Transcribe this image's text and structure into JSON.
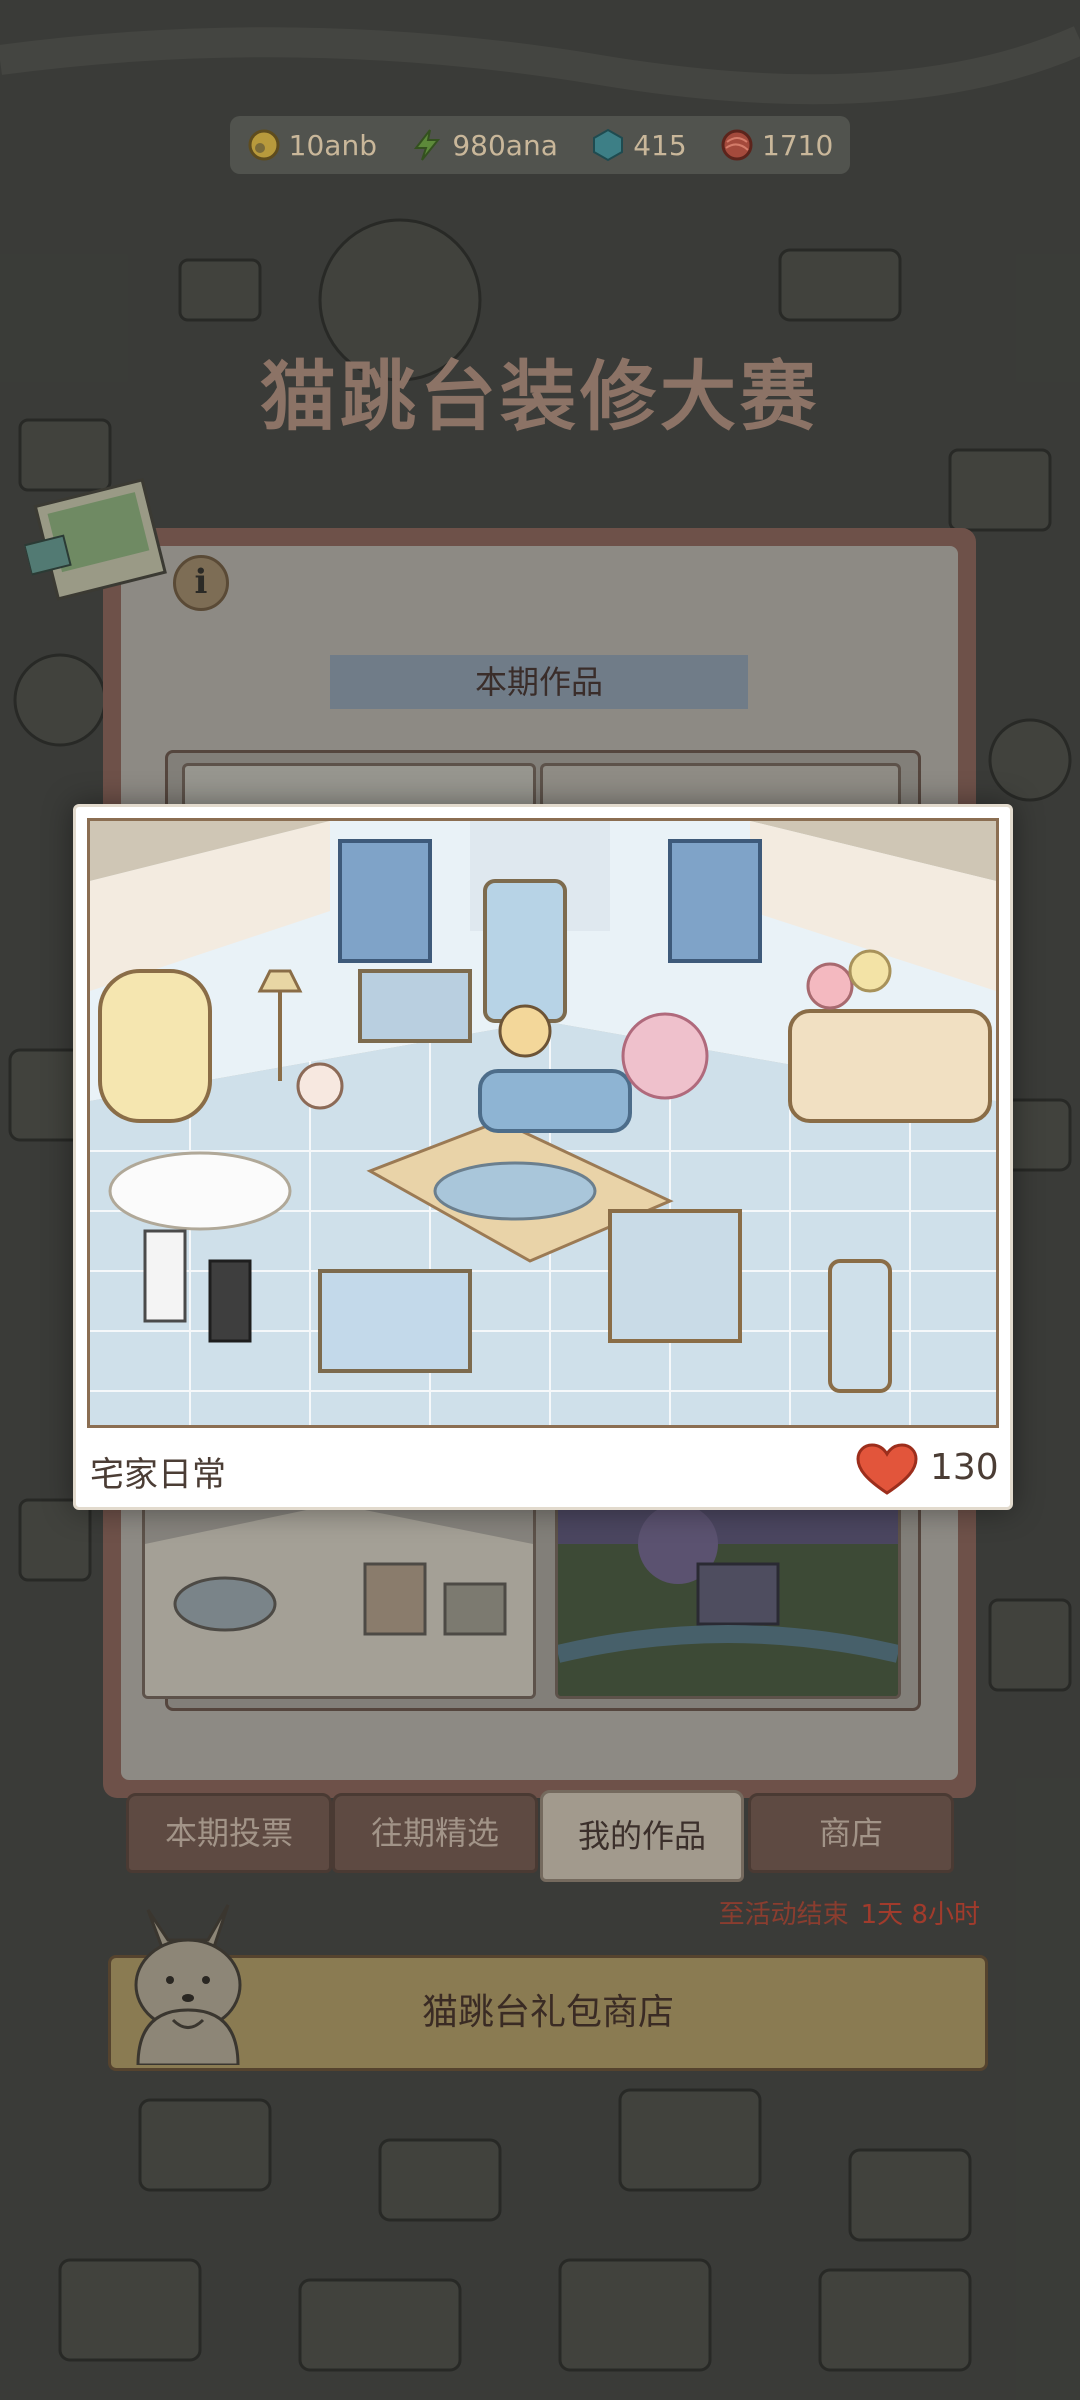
{
  "resources": [
    {
      "icon": "coin-icon",
      "value": "10anb"
    },
    {
      "icon": "energy-icon",
      "value": "980ana"
    },
    {
      "icon": "gem-icon",
      "value": "415"
    },
    {
      "icon": "yarn-icon",
      "value": "1710"
    }
  ],
  "event_title": "猫跳台装修大赛",
  "section_label": "本期作品",
  "tabs": [
    "本期投票",
    "往期精选",
    "我的作品",
    "商店"
  ],
  "active_tab": "我的作品",
  "countdown": {
    "label": "至活动结束",
    "value": "1天 8小时"
  },
  "shop_button": "猫跳台礼包商店",
  "popup": {
    "title": "宅家日常",
    "likes": "130"
  },
  "colors": {
    "accent_red": "#e2553b",
    "countdown_red": "#a13b2c",
    "board_brown": "#6e5149"
  }
}
